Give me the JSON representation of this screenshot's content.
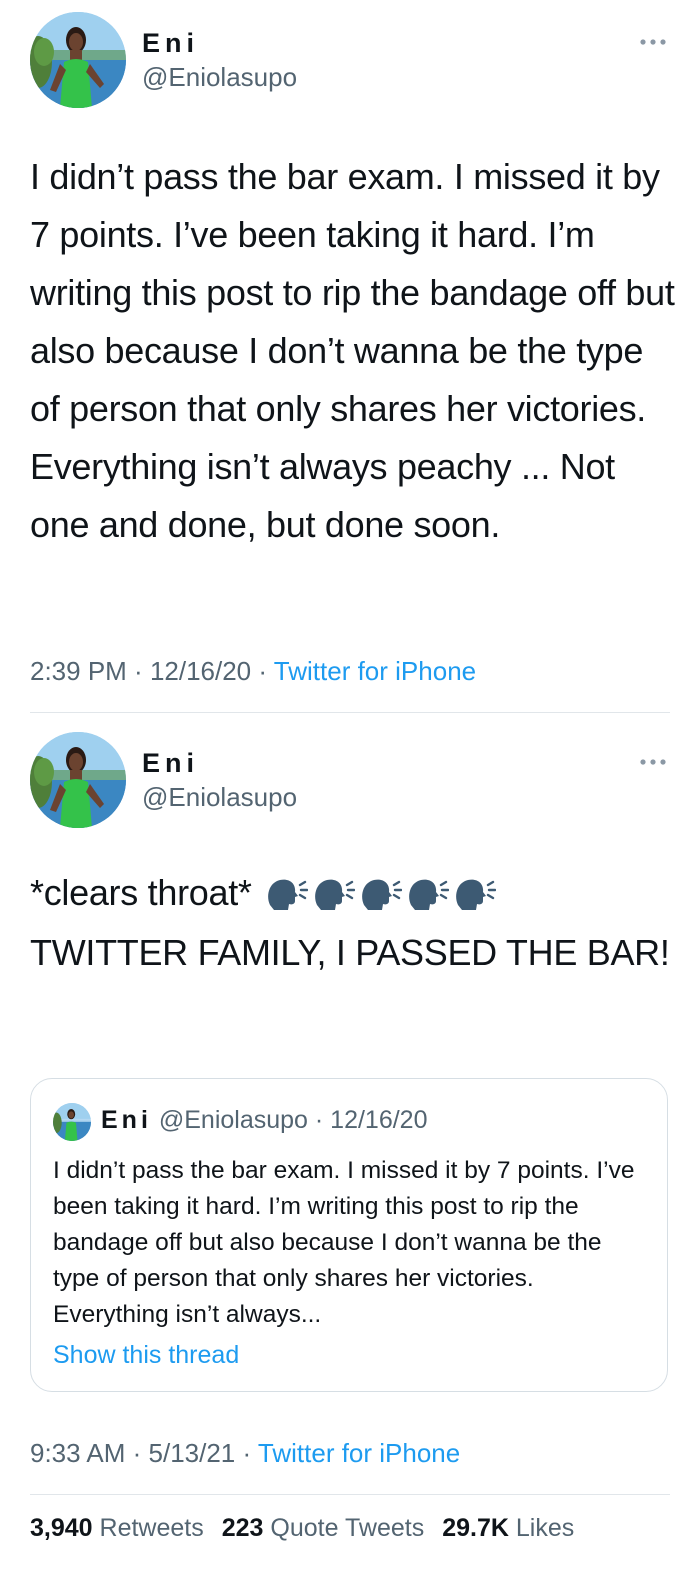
{
  "tweet1": {
    "author_name": "Eni",
    "author_handle": "@Eniolasupo",
    "text": "I didn’t pass the bar exam. I missed it by 7 points. I’ve been taking it hard. I’m writing this post to rip the bandage off but also because I don’t wanna be the type of person that only shares her victories. Everything isn’t always peachy ... Not one and done, but done soon.",
    "time": "2:39 PM",
    "date": "12/16/20",
    "source": "Twitter for iPhone"
  },
  "tweet2": {
    "author_name": "Eni",
    "author_handle": "@Eniolasupo",
    "text_line1": "*clears throat*",
    "text_line2": "TWITTER FAMILY, I PASSED THE BAR!",
    "emoji_icons": [
      "speaking-head-icon",
      "speaking-head-icon",
      "speaking-head-icon",
      "speaking-head-icon",
      "speaking-head-icon"
    ],
    "time": "9:33 AM",
    "date": "5/13/21",
    "source": "Twitter for iPhone",
    "quote": {
      "author_name": "Eni",
      "author_handle": "@Eniolasupo",
      "date": "12/16/20",
      "text": "I didn’t pass the bar exam. I missed it by 7 points. I’ve been taking it hard. I’m writing this post to rip the bandage off but also because I don’t wanna be the type of person that only shares her victories. Everything isn’t always...",
      "show_thread": "Show this thread"
    },
    "stats": {
      "retweets_count": "3,940",
      "retweets_label": "Retweets",
      "quotes_count": "223",
      "quotes_label": "Quote Tweets",
      "likes_count": "29.7K",
      "likes_label": "Likes"
    }
  },
  "colors": {
    "link": "#1d9bf0",
    "secondary_text": "#536471",
    "primary_text": "#0f1419",
    "divider": "#e1e6ea"
  }
}
